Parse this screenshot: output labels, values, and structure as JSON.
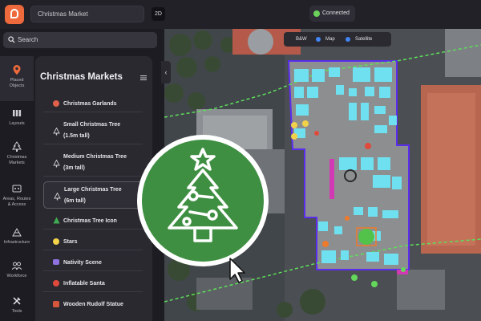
{
  "header": {
    "project_name": "Christmas Market",
    "view_mode": "2D",
    "status": "Connected"
  },
  "search": {
    "placeholder": "Search"
  },
  "rail": [
    {
      "label_1": "Placed",
      "label_2": "Objects",
      "icon": "pin-icon"
    },
    {
      "label_1": "Layouts",
      "label_2": "",
      "icon": "layouts-icon"
    },
    {
      "label_1": "Christmas",
      "label_2": "Markets",
      "icon": "tree-icon"
    },
    {
      "label_1": "Areas, Routes",
      "label_2": "& Access",
      "icon": "routes-icon"
    },
    {
      "label_1": "Infrastructure",
      "label_2": "",
      "icon": "infrastructure-icon"
    },
    {
      "label_1": "Workforce",
      "label_2": "",
      "icon": "workforce-icon"
    },
    {
      "label_1": "Tools",
      "label_2": "",
      "icon": "tools-icon"
    }
  ],
  "panel": {
    "title": "Christmas Markets",
    "items": [
      {
        "line1": "Christmas Garlands",
        "line2": "",
        "icon": "garland-icon",
        "color": "#e0604a"
      },
      {
        "line1": "Small Christmas Tree",
        "line2": "(1.5m tall)",
        "icon": "tree-outline-icon",
        "color": "#cfcfd4"
      },
      {
        "line1": "Medium Christmas Tree",
        "line2": "(3m tall)",
        "icon": "tree-outline-icon",
        "color": "#cfcfd4"
      },
      {
        "line1": "Large Christmas Tree",
        "line2": "(6m tall)",
        "icon": "tree-outline-icon",
        "color": "#cfcfd4"
      },
      {
        "line1": "Christmas Tree Icon",
        "line2": "",
        "icon": "tree-green-icon",
        "color": "#3fae4f"
      },
      {
        "line1": "Stars",
        "line2": "",
        "icon": "star-icon",
        "color": "#f2d34a"
      },
      {
        "line1": "Nativity Scene",
        "line2": "",
        "icon": "nativity-icon",
        "color": "#8f72e0"
      },
      {
        "line1": "Inflatable Santa",
        "line2": "",
        "icon": "santa-icon",
        "color": "#e04a3c"
      },
      {
        "line1": "Wooden Rudolf Statue",
        "line2": "",
        "icon": "reindeer-icon",
        "color": "#d6563b"
      }
    ]
  },
  "map_toggle": {
    "bw": "B&W",
    "map": "Map",
    "satellite": "Satellite"
  },
  "colors": {
    "accent": "#ee6a3c",
    "connected": "#6bd35b",
    "tree_badge": "#3f8f43",
    "stall": "#6fe0ef",
    "boundary": "#5a2df0"
  }
}
